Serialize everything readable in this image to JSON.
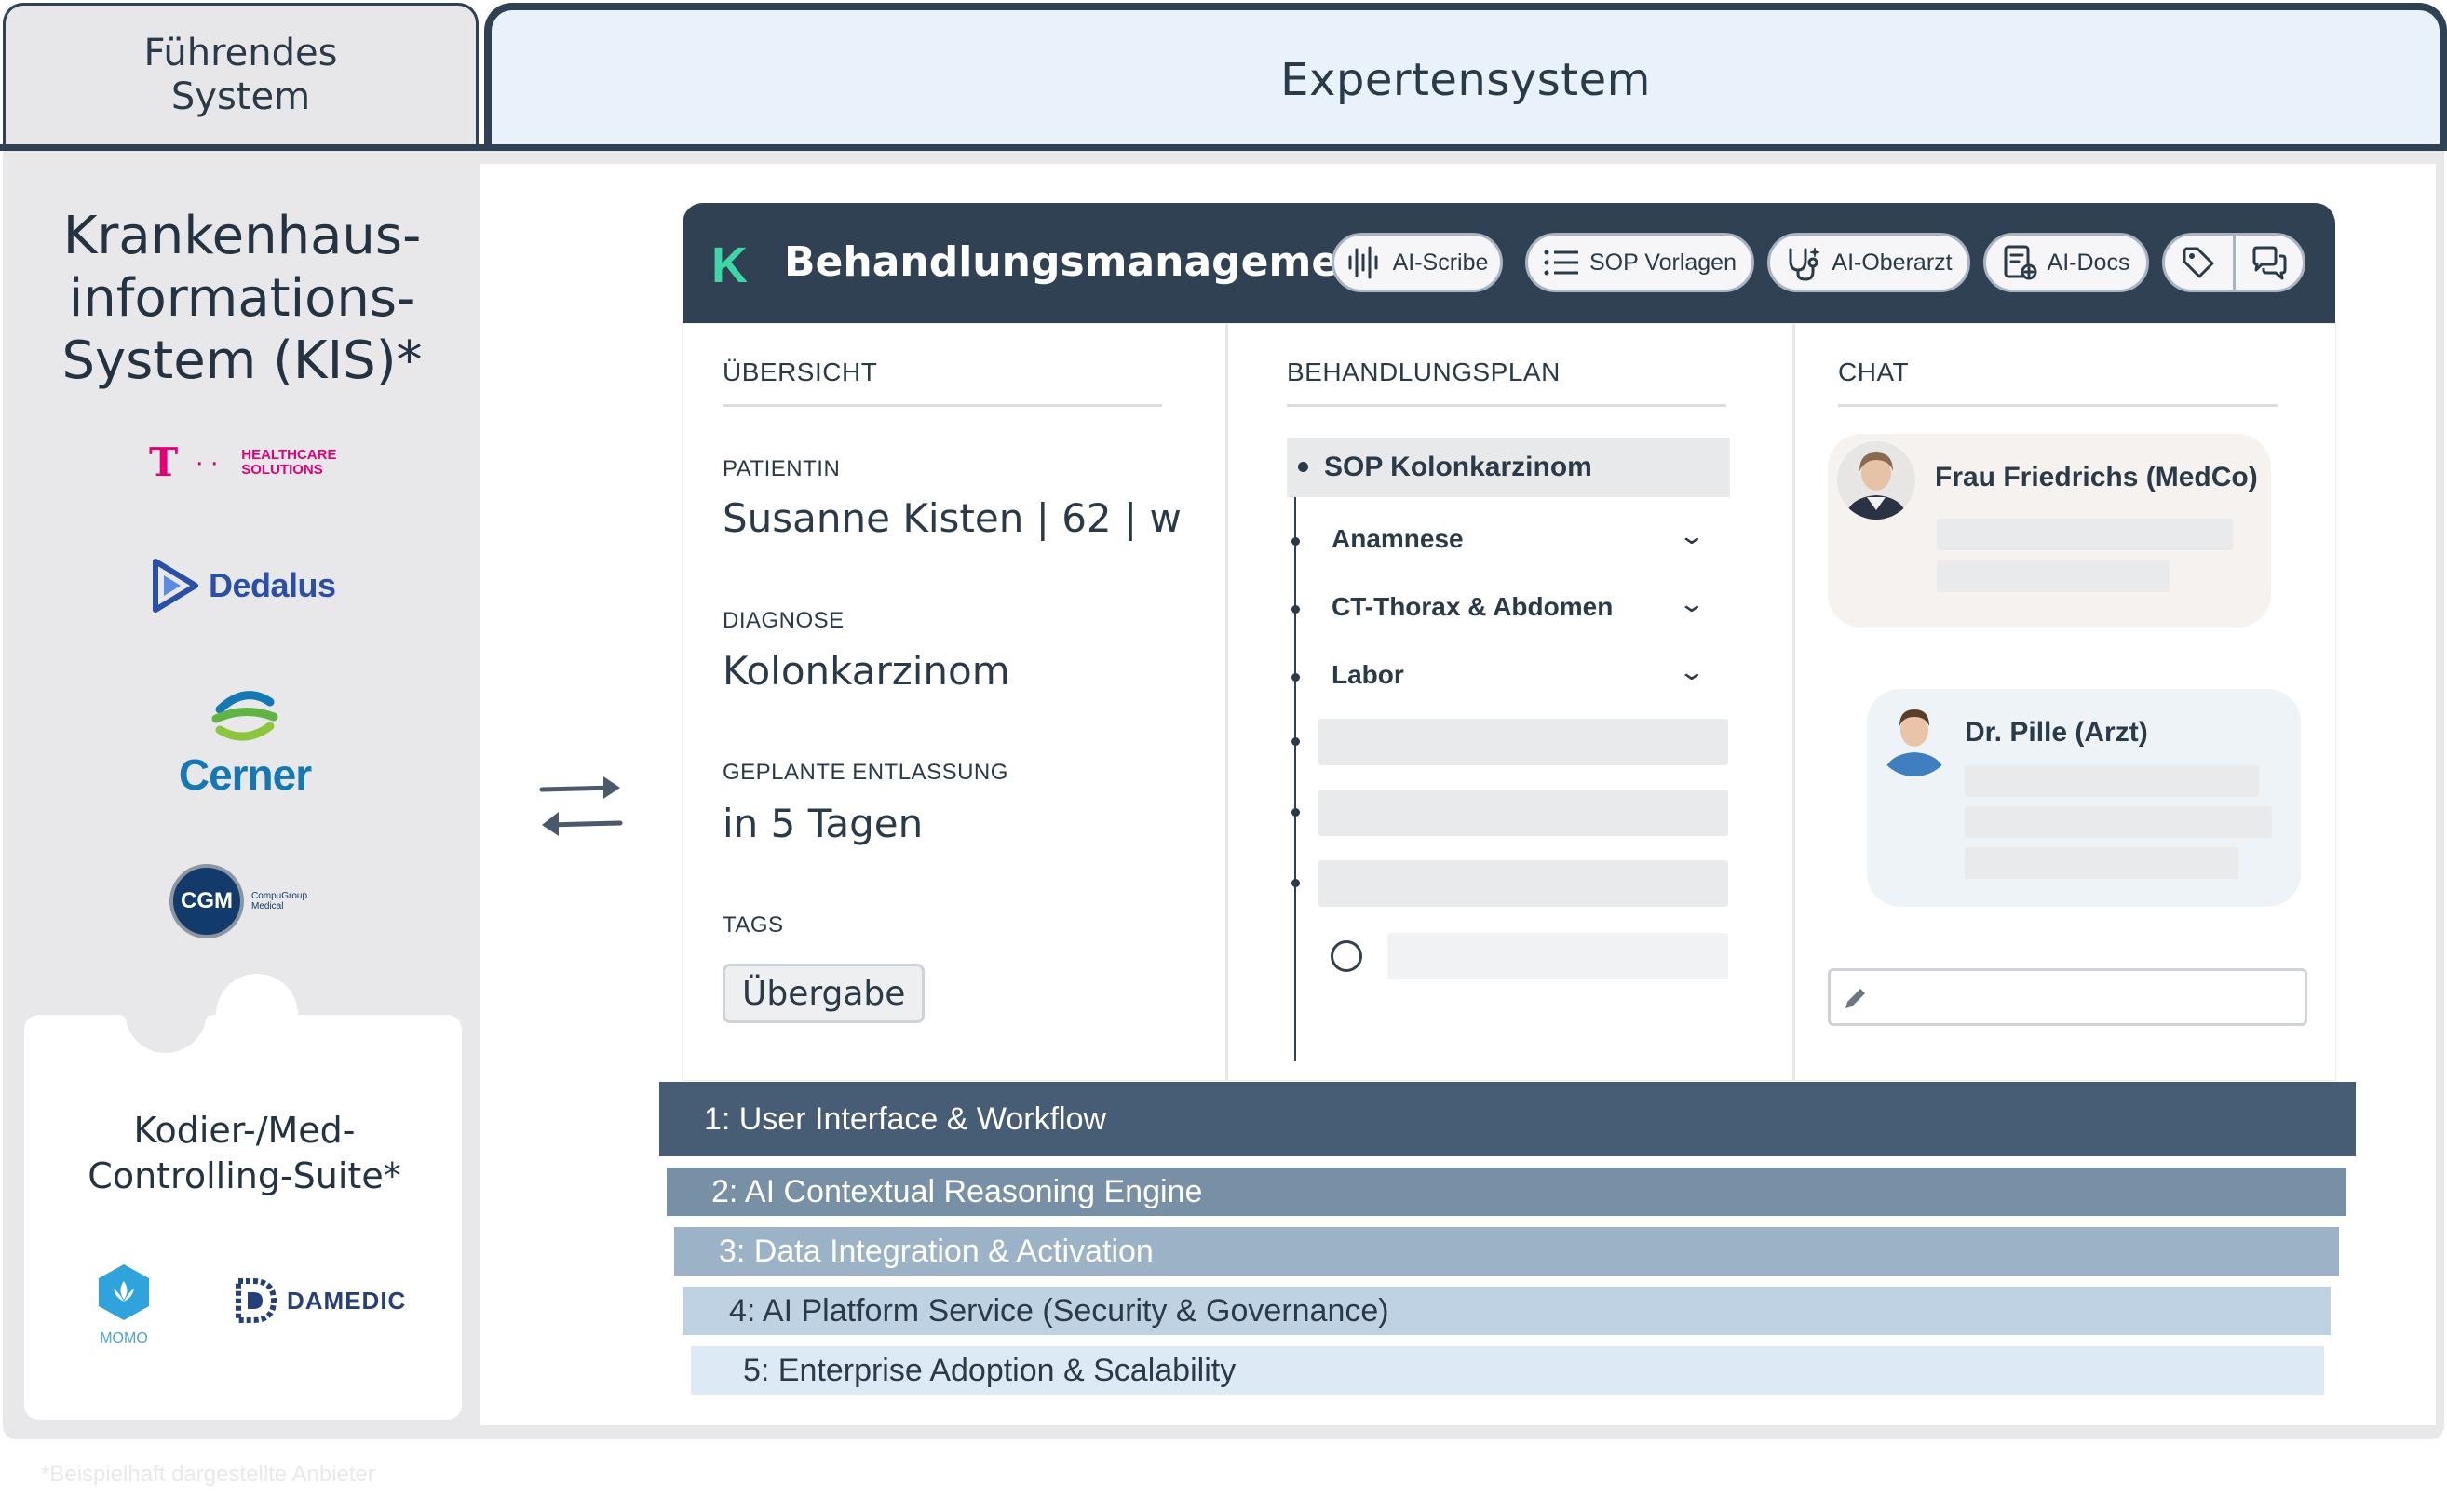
{
  "tabs": {
    "left": "Führendes\nSystem",
    "right": "Expertensystem"
  },
  "kis": {
    "title": "Krankenhaus-\ninformations-\nSystem (KIS)*",
    "logos": {
      "telekom_mark": "T",
      "telekom_sub": "HEALTHCARE\nSOLUTIONS",
      "dedalus": "Dedalus",
      "cerner": "Cerner",
      "cgm": "CGM",
      "cgm_sub": "CompuGroup\nMedical"
    }
  },
  "kodier": {
    "title": "Kodier-/Med-\nControlling-Suite*",
    "logos": {
      "momo": "MOMO",
      "damedic": "DAMEDIC"
    }
  },
  "app": {
    "logo": "K",
    "title": "Behandlungsmanagement",
    "toolbar": [
      {
        "label": "AI-Scribe",
        "icon": "waveform-icon"
      },
      {
        "label": "SOP Vorlagen",
        "icon": "list-icon"
      },
      {
        "label": "AI-Oberarzt",
        "icon": "stethoscope-icon"
      },
      {
        "label": "AI-Docs",
        "icon": "document-icon"
      }
    ],
    "toolbar_extra": [
      "tag-icon",
      "chat-icon"
    ]
  },
  "overview": {
    "heading": "ÜBERSICHT",
    "patient_label": "PATIENTIN",
    "patient_value": "Susanne Kisten | 62 | w",
    "diagnosis_label": "DIAGNOSE",
    "diagnosis_value": "Kolonkarzinom",
    "discharge_label": "GEPLANTE ENTLASSUNG",
    "discharge_value": "in 5 Tagen",
    "tags_label": "TAGS",
    "tag": "Übergabe"
  },
  "plan": {
    "heading": "BEHANDLUNGSPLAN",
    "active": "SOP Kolonkarzinom",
    "items": [
      "Anamnese",
      "CT-Thorax & Abdomen",
      "Labor"
    ]
  },
  "chat": {
    "heading": "CHAT",
    "messages": [
      {
        "sender": "Frau Friedrichs (MedCo)"
      },
      {
        "sender": "Dr. Pille (Arzt)"
      }
    ]
  },
  "layers": [
    "1: User Interface & Workflow",
    "2: AI Contextual Reasoning Engine",
    "3: Data Integration & Activation",
    "4: AI Platform Service (Security & Governance)",
    "5: Enterprise Adoption & Scalability"
  ],
  "colors": {
    "navy": "#2f4152",
    "layer1": "#475d75",
    "layer2": "#7890a6",
    "layer3": "#9cb2c7",
    "layer4": "#bfd2e3",
    "layer5": "#dde9f5",
    "accent_green": "#3dd6a6"
  },
  "footnote": "*Beispielhaft dargestellte Anbieter"
}
